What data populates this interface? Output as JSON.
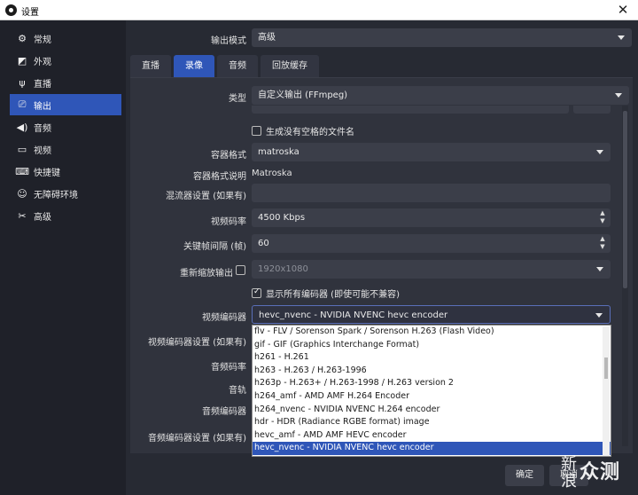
{
  "window": {
    "title": "设置",
    "close_glyph": "✕"
  },
  "sidebar": {
    "items": [
      {
        "label": "常规",
        "icon": "gear-icon",
        "glyph": "⚙"
      },
      {
        "label": "外观",
        "icon": "appearance-icon",
        "glyph": "◩"
      },
      {
        "label": "直播",
        "icon": "antenna-icon",
        "glyph": "📡"
      },
      {
        "label": "输出",
        "icon": "output-icon",
        "glyph": "⎚",
        "active": true
      },
      {
        "label": "音频",
        "icon": "speaker-icon",
        "glyph": "🔊"
      },
      {
        "label": "视频",
        "icon": "monitor-icon",
        "glyph": "▭"
      },
      {
        "label": "快捷键",
        "icon": "keyboard-icon",
        "glyph": "⌨"
      },
      {
        "label": "无障碍环境",
        "icon": "accessibility-icon",
        "glyph": "♿"
      },
      {
        "label": "高级",
        "icon": "tools-icon",
        "glyph": "✂"
      }
    ]
  },
  "output_mode": {
    "label": "输出模式",
    "value": "高级"
  },
  "tabs": [
    {
      "label": "直播"
    },
    {
      "label": "录像",
      "active": true
    },
    {
      "label": "音频"
    },
    {
      "label": "回放缓存"
    }
  ],
  "recording": {
    "type": {
      "label": "类型",
      "value": "自定义输出 (FFmpeg)"
    },
    "no_space_filename": {
      "label": "生成没有空格的文件名",
      "checked": false
    },
    "container_format": {
      "label": "容器格式",
      "value": "matroska"
    },
    "container_desc": {
      "label": "容器格式说明",
      "value": "Matroska"
    },
    "muxer_settings": {
      "label": "混流器设置 (如果有)",
      "value": ""
    },
    "video_bitrate": {
      "label": "视频码率",
      "value": "4500 Kbps"
    },
    "keyframe_interval": {
      "label": "关键帧间隔 (帧)",
      "value": "60"
    },
    "rescale_output": {
      "label": "重新缩放输出",
      "value": "1920x1080",
      "checked": false
    },
    "show_all_codecs": {
      "label": "显示所有编码器 (即使可能不兼容)",
      "checked": true
    },
    "video_encoder": {
      "label": "视频编码器",
      "value": "hevc_nvenc - NVIDIA NVENC hevc encoder"
    },
    "video_encoder_settings": {
      "label": "视频编码器设置 (如果有)"
    },
    "audio_bitrate": {
      "label": "音频码率"
    },
    "audio_track": {
      "label": "音轨"
    },
    "audio_encoder": {
      "label": "音频编码器"
    },
    "audio_encoder_settings": {
      "label": "音频编码器设置 (如果有)"
    }
  },
  "encoder_dropdown": {
    "options": [
      "flv - FLV / Sorenson Spark / Sorenson H.263 (Flash Video)",
      "gif - GIF (Graphics Interchange Format)",
      "h261 - H.261",
      "h263 - H.263 / H.263-1996",
      "h263p - H.263+ / H.263-1998 / H.263 version 2",
      "h264_amf - AMD AMF H.264 Encoder",
      "h264_nvenc - NVIDIA NVENC H.264 encoder",
      "hdr - HDR (Radiance RGBE format) image",
      "hevc_amf - AMD AMF HEVC encoder",
      "hevc_nvenc - NVIDIA NVENC hevc encoder"
    ],
    "selected_index": 9
  },
  "buttons": {
    "ok": "确定",
    "cancel": "取消"
  },
  "watermark": {
    "text_a": "新浪",
    "text_b": "众测"
  },
  "colors": {
    "accent": "#2f56b8",
    "sidebar_bg": "#1f2129",
    "main_bg": "#272a33",
    "field_bg": "#3b3e49"
  }
}
